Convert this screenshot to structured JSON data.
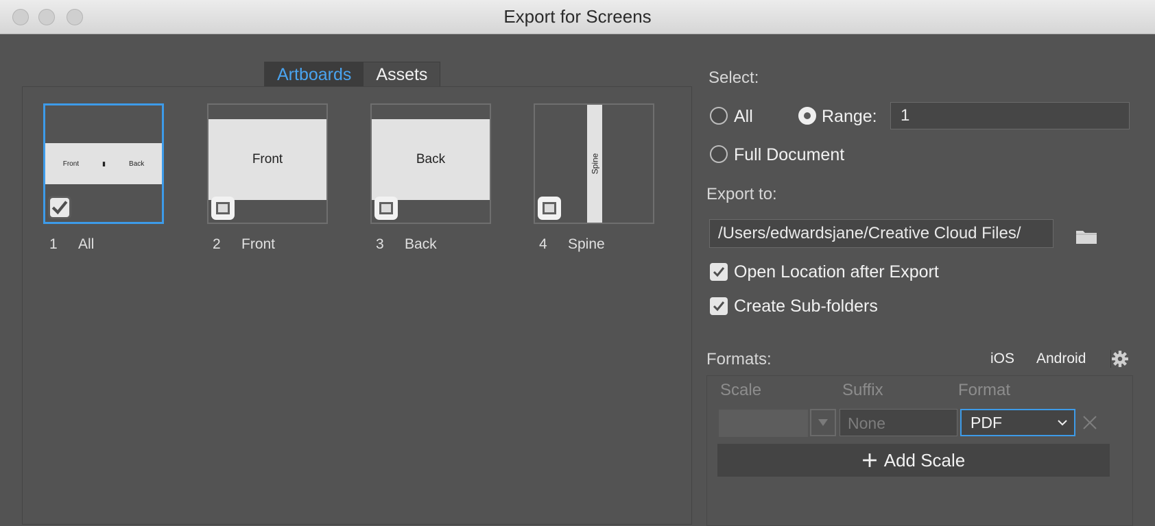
{
  "window": {
    "title": "Export for Screens"
  },
  "tabs": [
    {
      "label": "Artboards"
    },
    {
      "label": "Assets"
    }
  ],
  "artboards": [
    {
      "num": "1",
      "name": "All",
      "thumb": {
        "a": "Front",
        "b": "Back"
      },
      "checked": true
    },
    {
      "num": "2",
      "name": "Front",
      "thumb": {
        "text": "Front"
      },
      "checked": false
    },
    {
      "num": "3",
      "name": "Back",
      "thumb": {
        "text": "Back"
      },
      "checked": false
    },
    {
      "num": "4",
      "name": "Spine",
      "thumb": {
        "text": "Spine"
      },
      "checked": false
    }
  ],
  "select": {
    "label": "Select:",
    "all": "All",
    "range": "Range:",
    "range_value": "1",
    "full_document": "Full Document",
    "selected": "range"
  },
  "export_to": {
    "label": "Export to:",
    "path": "/Users/edwardsjane/Creative Cloud Files/"
  },
  "options": {
    "open_location": "Open Location after Export",
    "open_location_checked": true,
    "create_subfolders": "Create Sub-folders",
    "create_subfolders_checked": true
  },
  "formats": {
    "label": "Formats:",
    "ios": "iOS",
    "android": "Android",
    "col_scale": "Scale",
    "col_suffix": "Suffix",
    "col_format": "Format",
    "suffix_placeholder": "None",
    "format_value": "PDF",
    "add_scale": "Add Scale"
  },
  "colors": {
    "accent": "#3d9be9",
    "tab_active_text": "#4aa4f0",
    "background": "#535353"
  }
}
